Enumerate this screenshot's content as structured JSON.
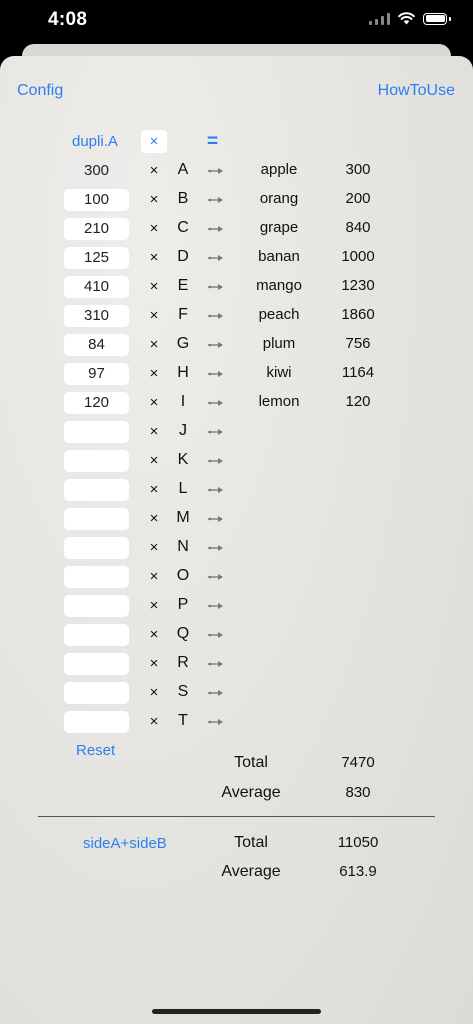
{
  "status": {
    "time": "4:08"
  },
  "nav": {
    "config": "Config",
    "howto": "HowToUse"
  },
  "header": {
    "dupli": "dupli.A",
    "multiply_toggle": "×",
    "equals": "="
  },
  "rows": [
    {
      "input": "300",
      "times": "×",
      "letter": "A",
      "name": "apple",
      "result": "300"
    },
    {
      "input": "100",
      "times": "×",
      "letter": "B",
      "name": "orang",
      "result": "200"
    },
    {
      "input": "210",
      "times": "×",
      "letter": "C",
      "name": "grape",
      "result": "840"
    },
    {
      "input": "125",
      "times": "×",
      "letter": "D",
      "name": "banan",
      "result": "1000"
    },
    {
      "input": "410",
      "times": "×",
      "letter": "E",
      "name": "mango",
      "result": "1230"
    },
    {
      "input": "310",
      "times": "×",
      "letter": "F",
      "name": "peach",
      "result": "1860"
    },
    {
      "input": "84",
      "times": "×",
      "letter": "G",
      "name": "plum",
      "result": "756"
    },
    {
      "input": "97",
      "times": "×",
      "letter": "H",
      "name": "kiwi",
      "result": "1164"
    },
    {
      "input": "120",
      "times": "×",
      "letter": "I",
      "name": "lemon",
      "result": "120"
    },
    {
      "input": "",
      "times": "×",
      "letter": "J",
      "name": "",
      "result": ""
    },
    {
      "input": "",
      "times": "×",
      "letter": "K",
      "name": "",
      "result": ""
    },
    {
      "input": "",
      "times": "×",
      "letter": "L",
      "name": "",
      "result": ""
    },
    {
      "input": "",
      "times": "×",
      "letter": "M",
      "name": "",
      "result": ""
    },
    {
      "input": "",
      "times": "×",
      "letter": "N",
      "name": "",
      "result": ""
    },
    {
      "input": "",
      "times": "×",
      "letter": "O",
      "name": "",
      "result": ""
    },
    {
      "input": "",
      "times": "×",
      "letter": "P",
      "name": "",
      "result": ""
    },
    {
      "input": "",
      "times": "×",
      "letter": "Q",
      "name": "",
      "result": ""
    },
    {
      "input": "",
      "times": "×",
      "letter": "R",
      "name": "",
      "result": ""
    },
    {
      "input": "",
      "times": "×",
      "letter": "S",
      "name": "",
      "result": ""
    },
    {
      "input": "",
      "times": "×",
      "letter": "T",
      "name": "",
      "result": ""
    }
  ],
  "reset": "Reset",
  "sideA": {
    "total_label": "Total",
    "total": "7470",
    "average_label": "Average",
    "average": "830"
  },
  "combined": {
    "link": "sideA+sideB",
    "total_label": "Total",
    "total": "11050",
    "average_label": "Average",
    "average": "613.9"
  },
  "colors": {
    "accent": "#2d7ff0",
    "background": "#e6e5e1"
  },
  "icons": {
    "arrow": "arrow-right-icon",
    "wifi": "wifi-icon",
    "battery": "battery-icon",
    "signal": "signal-icon"
  }
}
